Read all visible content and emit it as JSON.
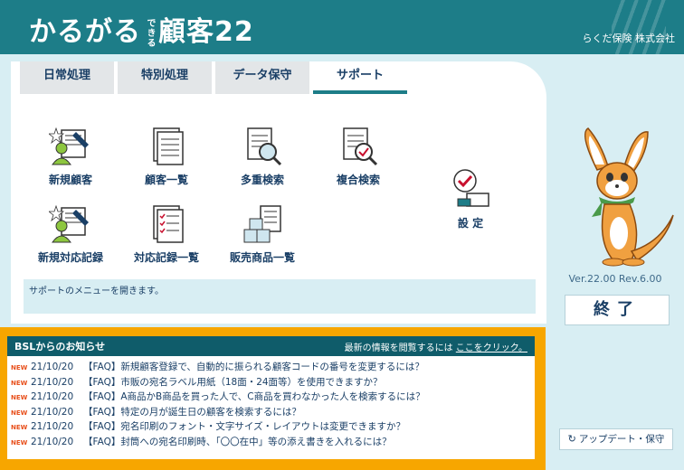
{
  "header": {
    "logo_main_1": "かるがる",
    "logo_small": "できる",
    "logo_main_2": "顧客22",
    "company": "らくだ保険 株式会社"
  },
  "tabs": [
    {
      "label": "日常処理",
      "active": false
    },
    {
      "label": "特別処理",
      "active": false
    },
    {
      "label": "データ保守",
      "active": false
    },
    {
      "label": "サポート",
      "active": true
    }
  ],
  "menu": {
    "items": [
      {
        "label": "新規顧客",
        "icon": "new-customer-icon"
      },
      {
        "label": "顧客一覧",
        "icon": "customer-list-icon"
      },
      {
        "label": "多重検索",
        "icon": "multi-search-icon"
      },
      {
        "label": "複合検索",
        "icon": "compound-search-icon"
      },
      {
        "label": "新規対応記録",
        "icon": "new-record-icon"
      },
      {
        "label": "対応記録一覧",
        "icon": "record-list-icon"
      },
      {
        "label": "販売商品一覧",
        "icon": "products-icon"
      },
      {
        "label": "設 定",
        "icon": "settings-icon"
      }
    ]
  },
  "status_text": "サポートのメニューを開きます。",
  "news": {
    "title": "BSLからのお知らせ",
    "link_prefix": "最新の情報を閲覧するには",
    "link_text": "ここをクリック。",
    "badge": "NEW",
    "items": [
      {
        "date": "21/10/20",
        "text": "【FAQ】新規顧客登録で、自動的に振られる顧客コードの番号を変更するには？"
      },
      {
        "date": "21/10/20",
        "text": "【FAQ】市販の宛名ラベル用紙（18面・24面等）を使用できますか？"
      },
      {
        "date": "21/10/20",
        "text": "【FAQ】A商品かB商品を買った人で、C商品を買わなかった人を検索するには？"
      },
      {
        "date": "21/10/20",
        "text": "【FAQ】特定の月が誕生日の顧客を検索するには？"
      },
      {
        "date": "21/10/20",
        "text": "【FAQ】宛名印刷のフォント・文字サイズ・レイアウトは変更できますか？"
      },
      {
        "date": "21/10/20",
        "text": "【FAQ】封筒への宛名印刷時、「〇〇在中」等の添え書きを入れるには？"
      }
    ]
  },
  "right": {
    "version": "Ver.22.00 Rev.6.00",
    "exit_label": "終了",
    "update_label": "アップデート・保守"
  },
  "colors": {
    "header": "#1d7d88",
    "news_border": "#f7a600",
    "news_head": "#0f5c6a",
    "background": "#d8eef3"
  }
}
